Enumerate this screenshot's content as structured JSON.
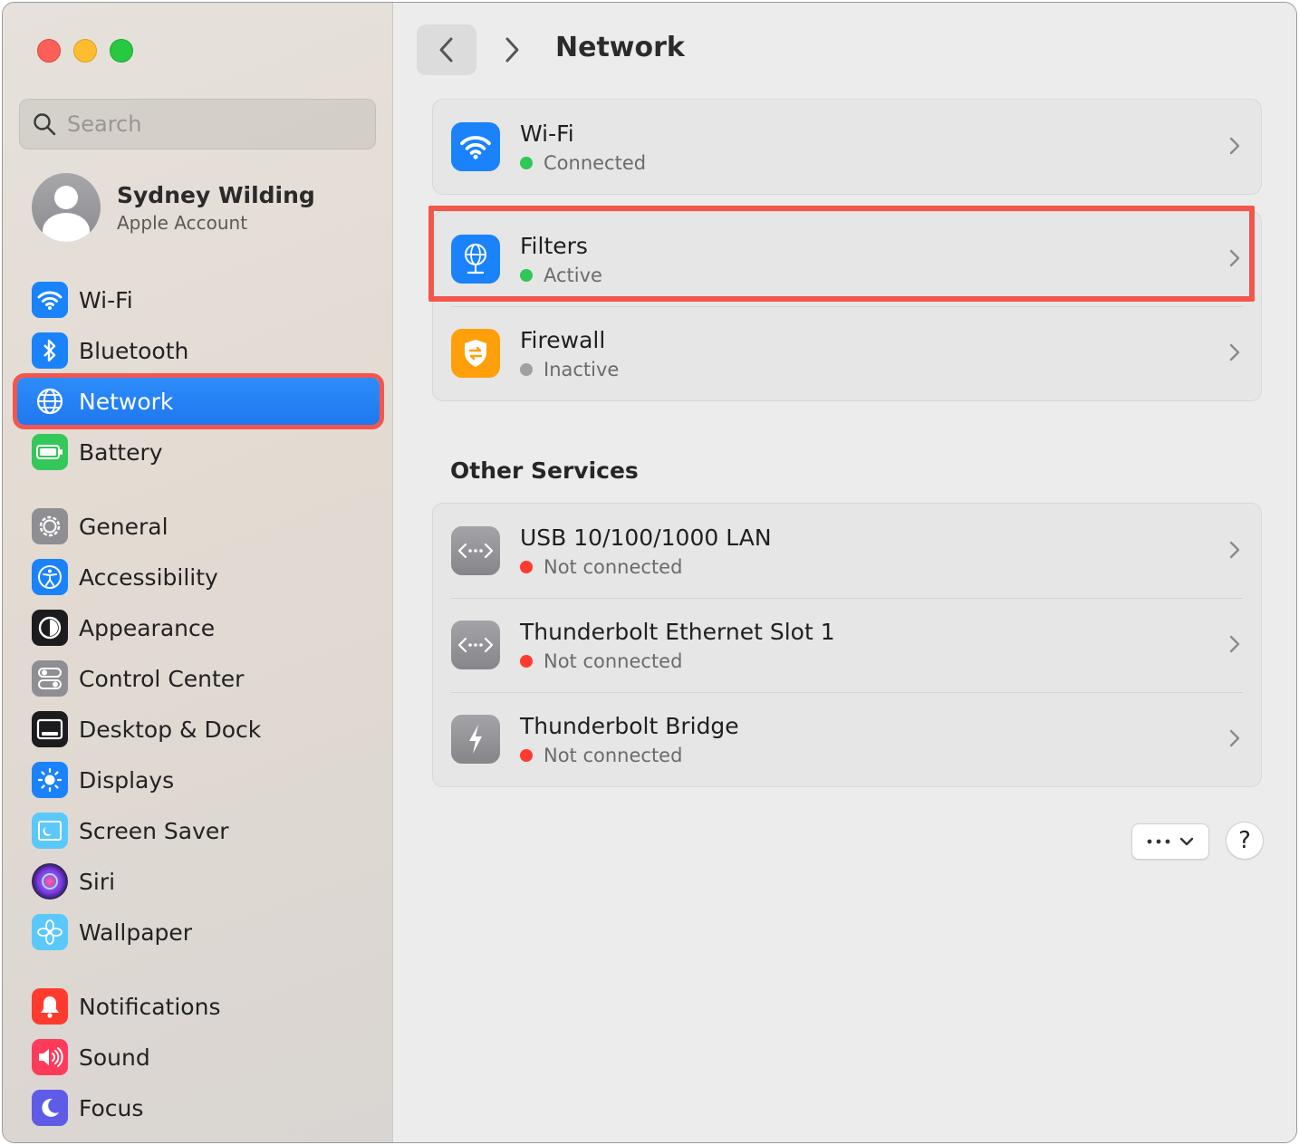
{
  "window": {
    "title": "Network"
  },
  "search": {
    "placeholder": "Search"
  },
  "account": {
    "name": "Sydney Wilding",
    "subtitle": "Apple Account"
  },
  "sidebar": {
    "group1": [
      {
        "label": "Wi-Fi",
        "icon": "wifi-icon",
        "color": "#1a82fb"
      },
      {
        "label": "Bluetooth",
        "icon": "bluetooth-icon",
        "color": "#1a82fb"
      },
      {
        "label": "Network",
        "icon": "globe-icon",
        "color": "#1a82fb",
        "selected": true
      },
      {
        "label": "Battery",
        "icon": "battery-icon",
        "color": "#34c759"
      }
    ],
    "group2": [
      {
        "label": "General",
        "icon": "gear-icon",
        "color": "#8e8e93"
      },
      {
        "label": "Accessibility",
        "icon": "accessibility-icon",
        "color": "#1a82fb"
      },
      {
        "label": "Appearance",
        "icon": "appearance-icon",
        "color": "#1c1c1e"
      },
      {
        "label": "Control Center",
        "icon": "toggles-icon",
        "color": "#8e8e93"
      },
      {
        "label": "Desktop & Dock",
        "icon": "dock-icon",
        "color": "#1c1c1e"
      },
      {
        "label": "Displays",
        "icon": "sun-icon",
        "color": "#1a82fb"
      },
      {
        "label": "Screen Saver",
        "icon": "screen-saver-icon",
        "color": "#5ac8fa"
      },
      {
        "label": "Siri",
        "icon": "siri-icon",
        "color": "#6e3cd8"
      },
      {
        "label": "Wallpaper",
        "icon": "flower-icon",
        "color": "#5ac8fa"
      }
    ],
    "group3": [
      {
        "label": "Notifications",
        "icon": "bell-icon",
        "color": "#ff3b30"
      },
      {
        "label": "Sound",
        "icon": "speaker-icon",
        "color": "#ff3b5c"
      },
      {
        "label": "Focus",
        "icon": "moon-icon",
        "color": "#5e5ce6"
      }
    ]
  },
  "main": {
    "cards": [
      {
        "title": "Wi-Fi",
        "status": "Connected",
        "status_color": "#30c759",
        "icon": "wifi-icon",
        "color": "#1a82fb"
      },
      {
        "title": "Filters",
        "status": "Active",
        "status_color": "#30c759",
        "icon": "globe-filter-icon",
        "color": "#1a82fb"
      },
      {
        "title": "Firewall",
        "status": "Inactive",
        "status_color": "#a0a0a0",
        "icon": "firewall-shield-icon",
        "color": "#ff9f0a"
      }
    ],
    "other_services_title": "Other Services",
    "services": [
      {
        "title": "USB 10/100/1000 LAN",
        "status": "Not connected",
        "status_color": "#ff3b30",
        "icon": "ethernet-icon"
      },
      {
        "title": "Thunderbolt Ethernet Slot 1",
        "status": "Not connected",
        "status_color": "#ff3b30",
        "icon": "ethernet-icon"
      },
      {
        "title": "Thunderbolt Bridge",
        "status": "Not connected",
        "status_color": "#ff3b30",
        "icon": "thunderbolt-icon"
      }
    ],
    "help_label": "?"
  }
}
